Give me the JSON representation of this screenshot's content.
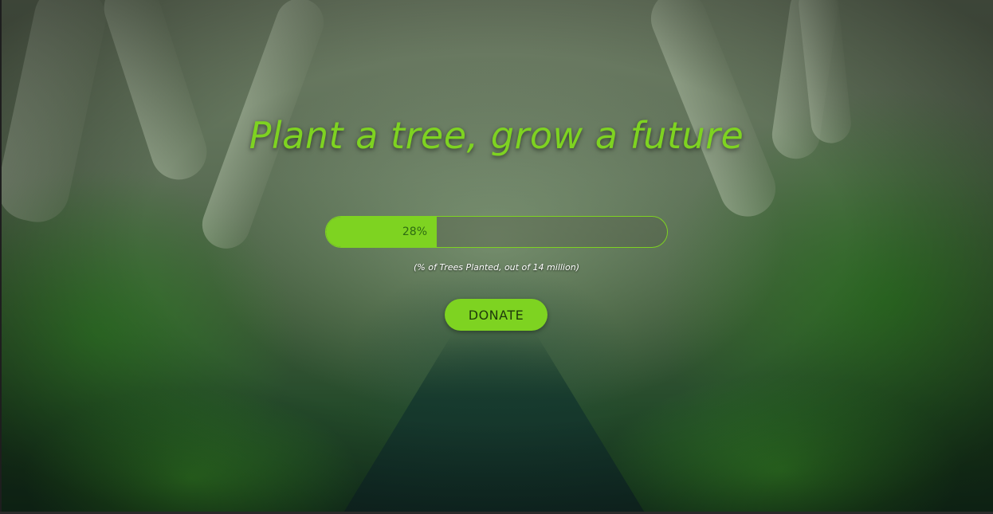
{
  "hero": {
    "headline": "Plant a tree, grow a future"
  },
  "progress": {
    "value_percent": 28,
    "label": "28%",
    "caption": "(% of Trees Planted, out of 14 million)"
  },
  "cta": {
    "donate_label": "DONATE"
  },
  "colors": {
    "accent": "#7ed321",
    "accent_text": "#2e6b12",
    "caption_text": "#ffffff"
  }
}
